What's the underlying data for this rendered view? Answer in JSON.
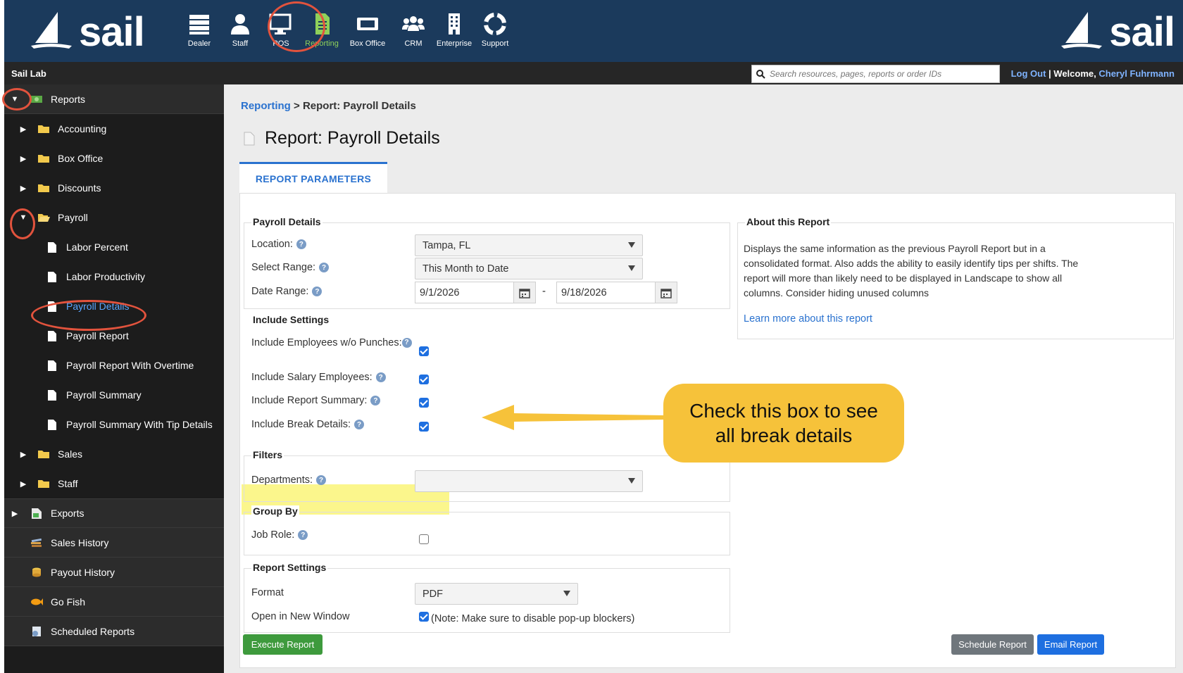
{
  "brand": {
    "name": "sail"
  },
  "nav": [
    {
      "label": "Dealer",
      "icon": "dealer-icon"
    },
    {
      "label": "Staff",
      "icon": "staff-icon"
    },
    {
      "label": "POS",
      "icon": "pos-icon"
    },
    {
      "label": "Reporting",
      "icon": "reporting-icon",
      "active": true
    },
    {
      "label": "Box Office",
      "icon": "ticket-icon"
    },
    {
      "label": "CRM",
      "icon": "crm-icon"
    },
    {
      "label": "Enterprise",
      "icon": "building-icon"
    },
    {
      "label": "Support",
      "icon": "lifebuoy-icon"
    }
  ],
  "subbar": {
    "lab_name": "Sail Lab",
    "search_placeholder": "Search resources, pages, reports or order IDs",
    "logout": "Log Out",
    "separator": "|",
    "welcome": "Welcome,",
    "user": "Cheryl Fuhrmann"
  },
  "sidebar": {
    "reports": "Reports",
    "accounting": "Accounting",
    "box_office": "Box Office",
    "discounts": "Discounts",
    "payroll": "Payroll",
    "labor_percent": "Labor Percent",
    "labor_productivity": "Labor Productivity",
    "payroll_details": "Payroll Details",
    "payroll_report": "Payroll Report",
    "payroll_report_overtime": "Payroll Report With Overtime",
    "payroll_summary": "Payroll Summary",
    "payroll_summary_tips": "Payroll Summary With Tip Details",
    "sales": "Sales",
    "staff": "Staff",
    "exports": "Exports",
    "sales_history": "Sales History",
    "payout_history": "Payout History",
    "go_fish": "Go Fish",
    "scheduled_reports": "Scheduled Reports"
  },
  "breadcrumb": {
    "link": "Reporting",
    "separator": ">",
    "current": "Report: Payroll Details"
  },
  "page_title": "Report: Payroll Details",
  "tab": "REPORT PARAMETERS",
  "payroll_details": {
    "legend": "Payroll Details",
    "location_label": "Location:",
    "location_value": "Tampa, FL",
    "range_label": "Select Range:",
    "range_value": "This Month to Date",
    "date_label": "Date Range:",
    "date_from": "9/1/2026",
    "date_sep": "-",
    "date_to": "9/18/2026"
  },
  "include_settings": {
    "legend": "Include Settings",
    "employees_wo_punches": "Include Employees w/o Punches:",
    "salary_employees": "Include Salary Employees:",
    "report_summary": "Include Report Summary:",
    "break_details": "Include Break Details:"
  },
  "filters": {
    "legend": "Filters",
    "departments_label": "Departments:",
    "departments_value": ""
  },
  "group_by": {
    "legend": "Group By",
    "job_role_label": "Job Role:"
  },
  "report_settings": {
    "legend": "Report Settings",
    "format_label": "Format",
    "format_value": "PDF",
    "open_new_label": "Open in New Window",
    "open_new_note": "(Note: Make sure to disable pop-up blockers)"
  },
  "about": {
    "legend": "About this Report",
    "text": "Displays the same information as the previous Payroll Report but in a consolidated format. Also adds the ability to easily identify tips per shifts. The report will more than likely need to be displayed in Landscape to show all columns. Consider hiding unused columns",
    "link": "Learn more about this report"
  },
  "buttons": {
    "execute": "Execute Report",
    "schedule": "Schedule Report",
    "email": "Email Report"
  },
  "callout": {
    "line1": "Check this box to see",
    "line2": "all break details"
  },
  "colors": {
    "topbar": "#1b3a5c",
    "accent": "#2a72cf",
    "active_nav": "#8fd05a",
    "callout": "#f6c23a",
    "highlight": "#fbf68c",
    "annotation": "#e2533d"
  }
}
